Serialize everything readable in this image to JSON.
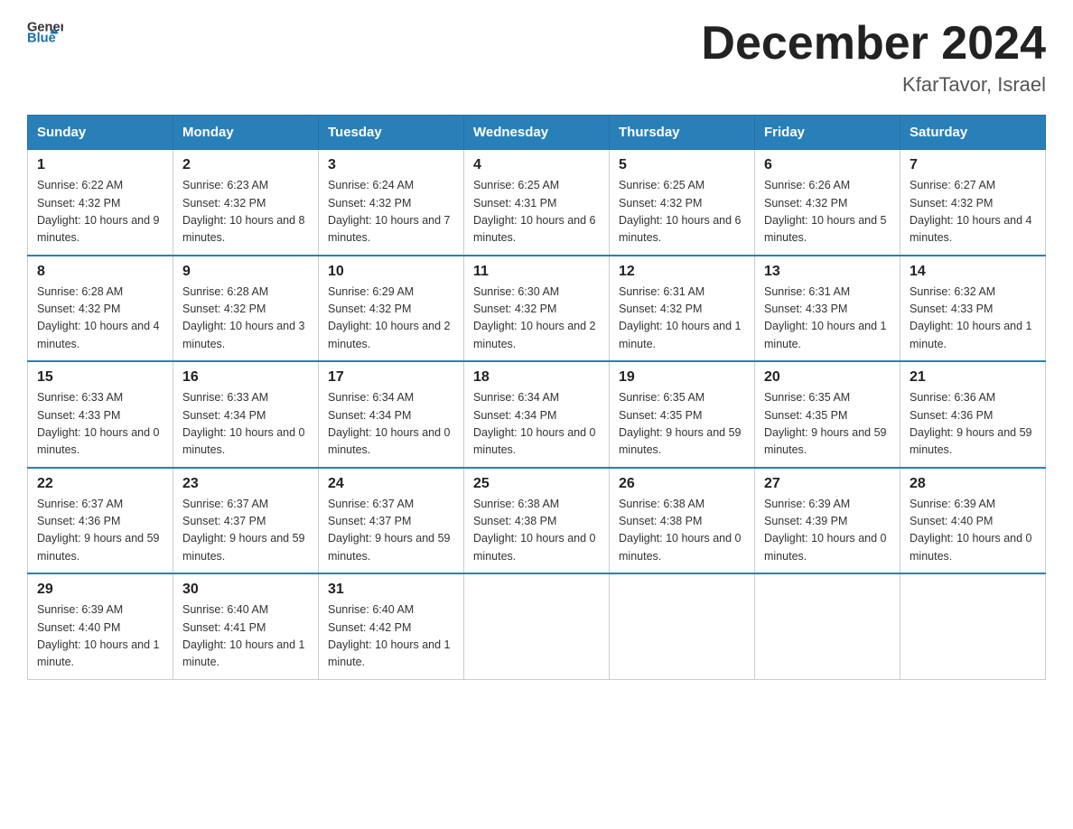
{
  "logo": {
    "text_general": "General",
    "text_blue": "Blue"
  },
  "title": {
    "month_year": "December 2024",
    "location": "KfarTavor, Israel"
  },
  "days_of_week": [
    "Sunday",
    "Monday",
    "Tuesday",
    "Wednesday",
    "Thursday",
    "Friday",
    "Saturday"
  ],
  "weeks": [
    [
      {
        "day": "1",
        "sunrise": "6:22 AM",
        "sunset": "4:32 PM",
        "daylight": "10 hours and 9 minutes."
      },
      {
        "day": "2",
        "sunrise": "6:23 AM",
        "sunset": "4:32 PM",
        "daylight": "10 hours and 8 minutes."
      },
      {
        "day": "3",
        "sunrise": "6:24 AM",
        "sunset": "4:32 PM",
        "daylight": "10 hours and 7 minutes."
      },
      {
        "day": "4",
        "sunrise": "6:25 AM",
        "sunset": "4:31 PM",
        "daylight": "10 hours and 6 minutes."
      },
      {
        "day": "5",
        "sunrise": "6:25 AM",
        "sunset": "4:32 PM",
        "daylight": "10 hours and 6 minutes."
      },
      {
        "day": "6",
        "sunrise": "6:26 AM",
        "sunset": "4:32 PM",
        "daylight": "10 hours and 5 minutes."
      },
      {
        "day": "7",
        "sunrise": "6:27 AM",
        "sunset": "4:32 PM",
        "daylight": "10 hours and 4 minutes."
      }
    ],
    [
      {
        "day": "8",
        "sunrise": "6:28 AM",
        "sunset": "4:32 PM",
        "daylight": "10 hours and 4 minutes."
      },
      {
        "day": "9",
        "sunrise": "6:28 AM",
        "sunset": "4:32 PM",
        "daylight": "10 hours and 3 minutes."
      },
      {
        "day": "10",
        "sunrise": "6:29 AM",
        "sunset": "4:32 PM",
        "daylight": "10 hours and 2 minutes."
      },
      {
        "day": "11",
        "sunrise": "6:30 AM",
        "sunset": "4:32 PM",
        "daylight": "10 hours and 2 minutes."
      },
      {
        "day": "12",
        "sunrise": "6:31 AM",
        "sunset": "4:32 PM",
        "daylight": "10 hours and 1 minute."
      },
      {
        "day": "13",
        "sunrise": "6:31 AM",
        "sunset": "4:33 PM",
        "daylight": "10 hours and 1 minute."
      },
      {
        "day": "14",
        "sunrise": "6:32 AM",
        "sunset": "4:33 PM",
        "daylight": "10 hours and 1 minute."
      }
    ],
    [
      {
        "day": "15",
        "sunrise": "6:33 AM",
        "sunset": "4:33 PM",
        "daylight": "10 hours and 0 minutes."
      },
      {
        "day": "16",
        "sunrise": "6:33 AM",
        "sunset": "4:34 PM",
        "daylight": "10 hours and 0 minutes."
      },
      {
        "day": "17",
        "sunrise": "6:34 AM",
        "sunset": "4:34 PM",
        "daylight": "10 hours and 0 minutes."
      },
      {
        "day": "18",
        "sunrise": "6:34 AM",
        "sunset": "4:34 PM",
        "daylight": "10 hours and 0 minutes."
      },
      {
        "day": "19",
        "sunrise": "6:35 AM",
        "sunset": "4:35 PM",
        "daylight": "9 hours and 59 minutes."
      },
      {
        "day": "20",
        "sunrise": "6:35 AM",
        "sunset": "4:35 PM",
        "daylight": "9 hours and 59 minutes."
      },
      {
        "day": "21",
        "sunrise": "6:36 AM",
        "sunset": "4:36 PM",
        "daylight": "9 hours and 59 minutes."
      }
    ],
    [
      {
        "day": "22",
        "sunrise": "6:37 AM",
        "sunset": "4:36 PM",
        "daylight": "9 hours and 59 minutes."
      },
      {
        "day": "23",
        "sunrise": "6:37 AM",
        "sunset": "4:37 PM",
        "daylight": "9 hours and 59 minutes."
      },
      {
        "day": "24",
        "sunrise": "6:37 AM",
        "sunset": "4:37 PM",
        "daylight": "9 hours and 59 minutes."
      },
      {
        "day": "25",
        "sunrise": "6:38 AM",
        "sunset": "4:38 PM",
        "daylight": "10 hours and 0 minutes."
      },
      {
        "day": "26",
        "sunrise": "6:38 AM",
        "sunset": "4:38 PM",
        "daylight": "10 hours and 0 minutes."
      },
      {
        "day": "27",
        "sunrise": "6:39 AM",
        "sunset": "4:39 PM",
        "daylight": "10 hours and 0 minutes."
      },
      {
        "day": "28",
        "sunrise": "6:39 AM",
        "sunset": "4:40 PM",
        "daylight": "10 hours and 0 minutes."
      }
    ],
    [
      {
        "day": "29",
        "sunrise": "6:39 AM",
        "sunset": "4:40 PM",
        "daylight": "10 hours and 1 minute."
      },
      {
        "day": "30",
        "sunrise": "6:40 AM",
        "sunset": "4:41 PM",
        "daylight": "10 hours and 1 minute."
      },
      {
        "day": "31",
        "sunrise": "6:40 AM",
        "sunset": "4:42 PM",
        "daylight": "10 hours and 1 minute."
      },
      null,
      null,
      null,
      null
    ]
  ]
}
